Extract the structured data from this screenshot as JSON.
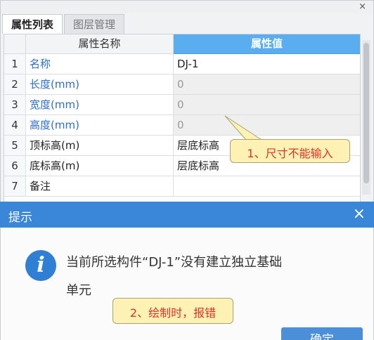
{
  "panel": {
    "close_glyph": "×",
    "tabs": [
      {
        "label": "属性列表",
        "active": true
      },
      {
        "label": "图层管理",
        "active": false
      }
    ],
    "columns": {
      "num": "",
      "name": "属性名称",
      "value": "属性值"
    },
    "rows": [
      {
        "num": "1",
        "name": "名称",
        "value": "DJ-1",
        "name_blue": true,
        "disabled": false
      },
      {
        "num": "2",
        "name": "长度(mm)",
        "value": "0",
        "name_blue": true,
        "disabled": true
      },
      {
        "num": "3",
        "name": "宽度(mm)",
        "value": "0",
        "name_blue": true,
        "disabled": true
      },
      {
        "num": "4",
        "name": "高度(mm)",
        "value": "0",
        "name_blue": true,
        "disabled": true
      },
      {
        "num": "5",
        "name": "顶标高(m)",
        "value": "层底标高",
        "name_blue": false,
        "disabled": false
      },
      {
        "num": "6",
        "name": "底标高(m)",
        "value": "层底标高",
        "name_blue": false,
        "disabled": false
      },
      {
        "num": "7",
        "name": "备注",
        "value": "",
        "name_blue": false,
        "disabled": false
      }
    ]
  },
  "annotations": {
    "note1": "1、尺寸不能输入",
    "note2": "2、绘制时，报错"
  },
  "dialog": {
    "title": "提示",
    "close_glyph": "×",
    "icon": "info-icon",
    "message_line1": "当前所选构件“DJ-1”没有建立独立基础",
    "message_line2": "单元",
    "ok_label": "确定"
  },
  "colors": {
    "header_accent": "#5aaef0",
    "dialog_title_bg": "#3a86d8",
    "property_name_blue": "#2b6fd1",
    "callout_fill": "#fdf2b3",
    "callout_text": "#e0302a"
  }
}
